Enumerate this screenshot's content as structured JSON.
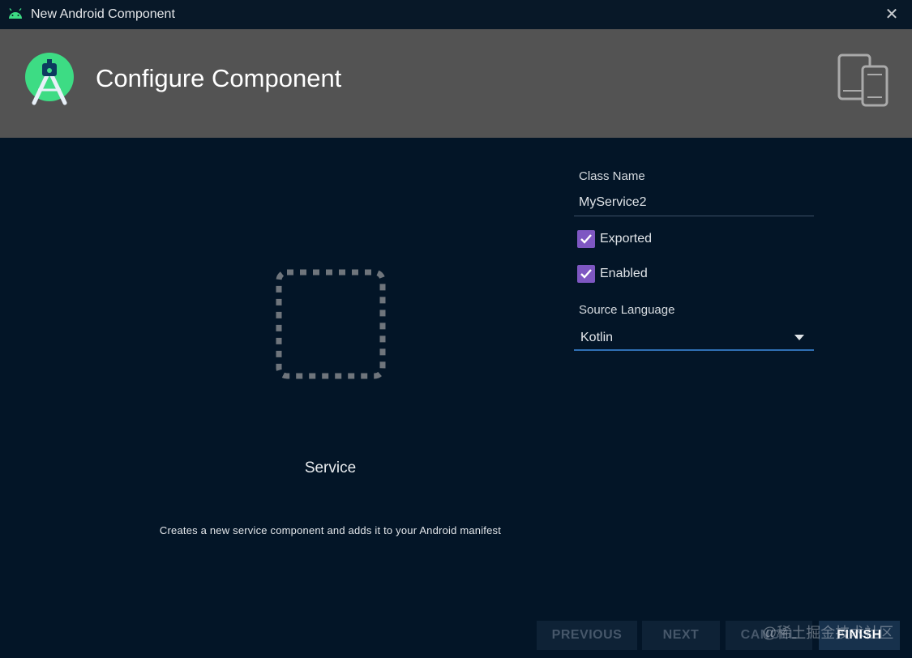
{
  "window": {
    "title": "New Android Component",
    "close_icon": "close-icon",
    "app_icon": "android-icon"
  },
  "header": {
    "title": "Configure Component",
    "logo_icon": "android-studio-logo-icon",
    "devices_icon": "devices-icon",
    "background": "#535353"
  },
  "preview": {
    "icon": "service-placeholder-icon",
    "name": "Service",
    "description": "Creates a new service component and adds it to your Android manifest"
  },
  "form": {
    "class_name_label": "Class Name",
    "class_name_value": "MyService2",
    "exported_label": "Exported",
    "exported_checked": true,
    "enabled_label": "Enabled",
    "enabled_checked": true,
    "source_language_label": "Source Language",
    "source_language_value": "Kotlin",
    "checkbox_color": "#7e57c2",
    "select_underline_color": "#2f6fb3"
  },
  "buttons": {
    "previous": "PREVIOUS",
    "next": "NEXT",
    "cancel": "CANCEL",
    "finish": "FINISH"
  },
  "watermark": "@稀土掘金技术社区",
  "theme": {
    "background": "#031527",
    "accent": "#3ddc84"
  }
}
